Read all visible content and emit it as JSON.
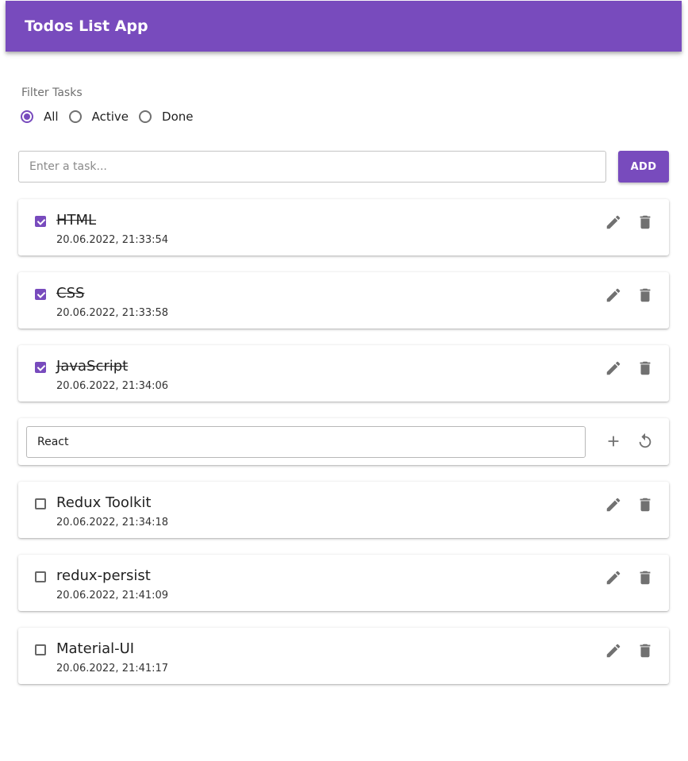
{
  "app": {
    "title": "Todos List App"
  },
  "filter": {
    "label": "Filter Tasks",
    "options": [
      {
        "label": "All",
        "checked": true
      },
      {
        "label": "Active",
        "checked": false
      },
      {
        "label": "Done",
        "checked": false
      }
    ]
  },
  "new_task": {
    "placeholder": "Enter a task...",
    "value": "",
    "add_label": "ADD"
  },
  "todos": [
    {
      "title": "HTML",
      "date": "20.06.2022, 21:33:54",
      "done": true
    },
    {
      "title": "CSS",
      "date": "20.06.2022, 21:33:58",
      "done": true
    },
    {
      "title": "JavaScript",
      "date": "20.06.2022, 21:34:06",
      "done": true
    },
    {
      "editing": true,
      "value": "React"
    },
    {
      "title": "Redux Toolkit",
      "date": "20.06.2022, 21:34:18",
      "done": false
    },
    {
      "title": "redux-persist",
      "date": "20.06.2022, 21:41:09",
      "done": false
    },
    {
      "title": "Material-UI",
      "date": "20.06.2022, 21:41:17",
      "done": false
    }
  ],
  "icons": {
    "edit": "pencil-icon",
    "delete": "trash-icon",
    "save": "plus-icon",
    "cancel": "undo-icon"
  },
  "colors": {
    "accent": "#784bbd",
    "icon": "#717171"
  }
}
